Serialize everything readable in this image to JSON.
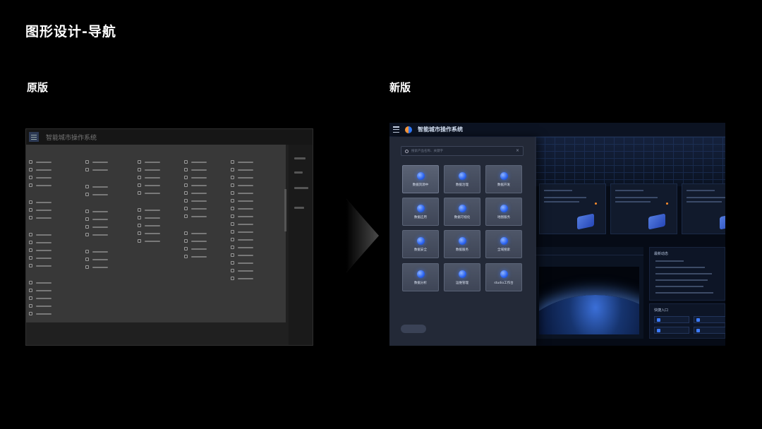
{
  "page": {
    "title": "图形设计-导航",
    "label_old": "原版",
    "label_new": "新版"
  },
  "old_version": {
    "app_title": "智能城市操作系统"
  },
  "new_version": {
    "app_title": "智能城市操作系统",
    "search_placeholder": "搜索产品名称、关键字",
    "search_clear": "×",
    "tiles": [
      "数据资源中",
      "数据治理",
      "数据开发",
      "数据应用",
      "数据可视化",
      "地图服务",
      "数据安全",
      "数据服务",
      "全域搜索",
      "数据分析",
      "运维管理",
      "studio工作台"
    ],
    "news_title": "最新动态",
    "quick_title": "快捷入口"
  },
  "colors": {
    "background": "#000000",
    "old_panel": "#383838",
    "new_overlay": "#282e3c",
    "accent_blue": "#2f7bff"
  }
}
